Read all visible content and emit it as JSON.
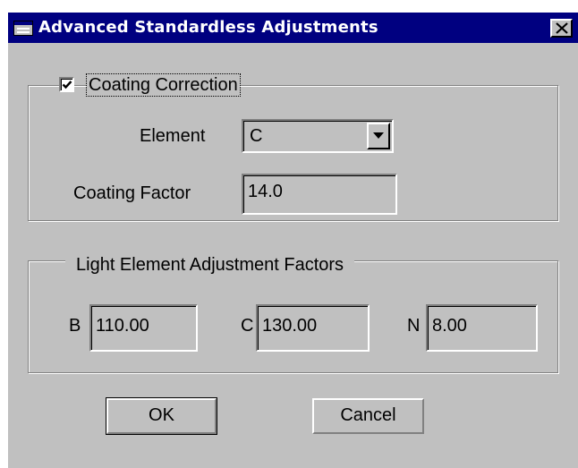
{
  "window": {
    "title": "Advanced Standardless Adjustments",
    "close_glyph": "✕"
  },
  "coating": {
    "checkbox_label": "Coating Correction",
    "checked": true,
    "element_label": "Element",
    "element_value": "C",
    "factor_label": "Coating Factor",
    "factor_value": "14.0"
  },
  "light": {
    "legend": "Light Element Adjustment Factors",
    "fields": [
      {
        "label": "B",
        "value": "110.00"
      },
      {
        "label": "C",
        "value": "130.00"
      },
      {
        "label": "N",
        "value": "8.00"
      }
    ]
  },
  "buttons": {
    "ok": "OK",
    "cancel": "Cancel"
  },
  "icons": {
    "window_icon": "dialog-window-icon",
    "close": "close-icon",
    "dropdown": "chevron-down-icon",
    "check": "checkmark-icon"
  },
  "colors": {
    "face": "#c0c0c0",
    "titlebar": "#000080"
  }
}
